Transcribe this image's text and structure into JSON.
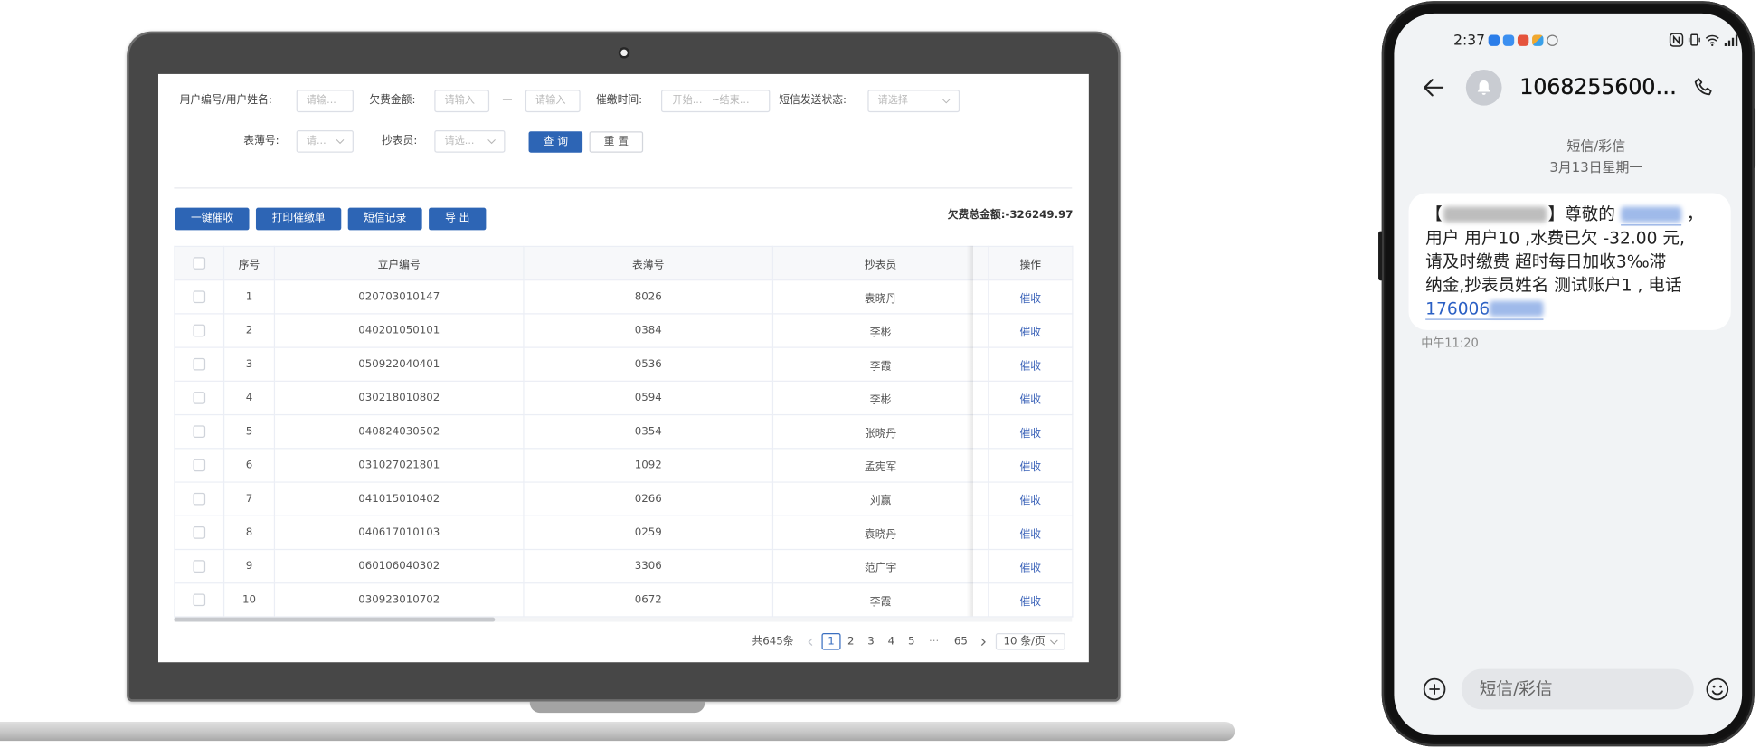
{
  "colors": {
    "primary": "#2d65b5",
    "link": "#3a62b8",
    "phone_link": "#2a5fc4"
  },
  "laptop": {
    "filters": {
      "user_label": "用户编号/用户姓名:",
      "user_placeholder": "请输...",
      "amount_label": "欠费金额:",
      "amount_min_placeholder": "请输入",
      "amount_separator": "—",
      "amount_max_placeholder": "请输入",
      "time_label": "催缴时间:",
      "time_start_placeholder": "开始...",
      "time_separator": "~",
      "time_end_placeholder": "结束...",
      "sms_status_label": "短信发送状态:",
      "sms_status_placeholder": "请选择",
      "book_label": "表薄号:",
      "book_placeholder": "请...",
      "reader_label": "抄表员:",
      "reader_placeholder": "请选...",
      "query_button": "查 询",
      "reset_button": "重 置"
    },
    "toolbar": {
      "collect_all_button": "一键催收",
      "print_button": "打印催缴单",
      "sms_log_button": "短信记录",
      "export_button": "导 出"
    },
    "total": {
      "label": "欠费总金额:",
      "value": "-326249.97"
    },
    "table": {
      "columns": [
        "序号",
        "立户编号",
        "表薄号",
        "抄表员",
        "操作"
      ],
      "action_label": "催收",
      "rows": [
        {
          "index": "1",
          "account": "020703010147",
          "book": "8026",
          "reader": "袁晓丹"
        },
        {
          "index": "2",
          "account": "040201050101",
          "book": "0384",
          "reader": "李彬"
        },
        {
          "index": "3",
          "account": "050922040401",
          "book": "0536",
          "reader": "李霞"
        },
        {
          "index": "4",
          "account": "030218010802",
          "book": "0594",
          "reader": "李彬"
        },
        {
          "index": "5",
          "account": "040824030502",
          "book": "0354",
          "reader": "张晓丹"
        },
        {
          "index": "6",
          "account": "031027021801",
          "book": "1092",
          "reader": "孟宪军"
        },
        {
          "index": "7",
          "account": "041015010402",
          "book": "0266",
          "reader": "刘赢"
        },
        {
          "index": "8",
          "account": "040617010103",
          "book": "0259",
          "reader": "袁晓丹"
        },
        {
          "index": "9",
          "account": "060106040302",
          "book": "3306",
          "reader": "范广宇"
        },
        {
          "index": "10",
          "account": "030923010702",
          "book": "0672",
          "reader": "李霞"
        }
      ]
    },
    "pagination": {
      "total": "共645条",
      "pages": [
        "1",
        "2",
        "3",
        "4",
        "5"
      ],
      "current": "1",
      "ellipsis": "···",
      "last": "65",
      "page_size": "10 条/页"
    }
  },
  "phone": {
    "status_bar": {
      "time": "2:37"
    },
    "header": {
      "title": "1068255600…"
    },
    "thread": {
      "category": "短信/彩信",
      "date": "3月13日星期一"
    },
    "message": {
      "open_bracket": "【",
      "greeting": "】尊敬的 ",
      "greeting_end": " ，",
      "line2": "用户 用户10 ,水费已欠 -32.00 元,",
      "line3": "请及时缴费 超时每日加收3‰滞",
      "line4": "纳金,抄表员姓名 测试账户1 , 电话",
      "phone_prefix": "176006",
      "time": "中午11:20"
    },
    "composer": {
      "placeholder": "短信/彩信"
    }
  }
}
